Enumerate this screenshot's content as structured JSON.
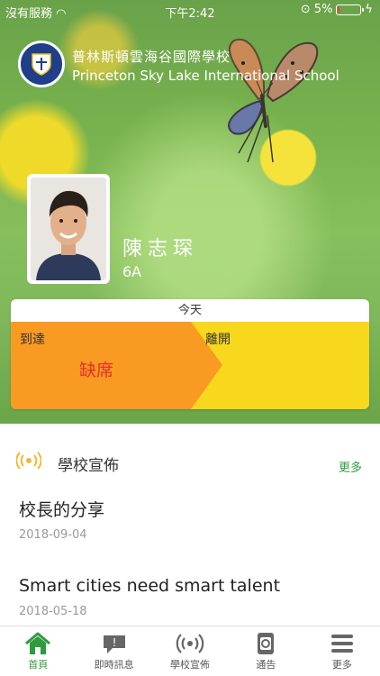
{
  "status_bar": {
    "carrier": "沒有服務",
    "time": "下午2:42",
    "battery_percent": "5%",
    "battery_level": 0.05
  },
  "school": {
    "name_zh": "普林斯頓雲海谷國際學校",
    "name_en": "Princeton Sky Lake International School"
  },
  "student": {
    "name": "陳志琛",
    "class": "6A"
  },
  "attendance": {
    "header": "今天",
    "arrive_label": "到達",
    "arrive_status": "缺席",
    "leave_label": "離開"
  },
  "announcements": {
    "title": "學校宣佈",
    "more_label": "更多",
    "items": [
      {
        "title": "校長的分享",
        "date": "2018-09-04"
      },
      {
        "title": "Smart cities need smart talent",
        "date": "2018-05-18"
      }
    ]
  },
  "tabbar": {
    "tabs": [
      {
        "label": "首頁",
        "icon": "home-icon",
        "active": true
      },
      {
        "label": "即時訊息",
        "icon": "message-icon",
        "active": false
      },
      {
        "label": "學校宣佈",
        "icon": "broadcast-icon",
        "active": false
      },
      {
        "label": "通告",
        "icon": "notice-icon",
        "active": false
      },
      {
        "label": "更多",
        "icon": "menu-icon",
        "active": false
      }
    ]
  },
  "colors": {
    "accent_green": "#2f9b3d",
    "arrive_orange": "#f99a22",
    "leave_yellow": "#f7d81c",
    "absent_red": "#e62e2e"
  }
}
